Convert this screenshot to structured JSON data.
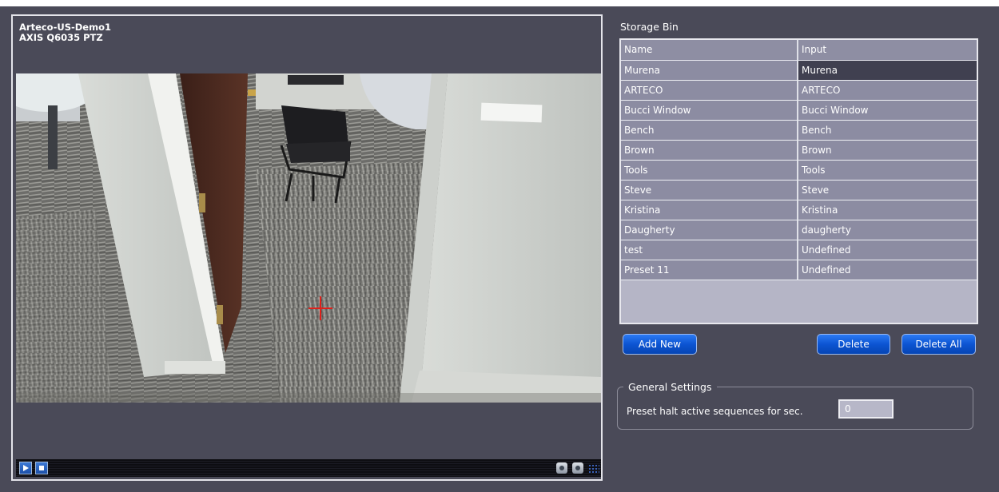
{
  "camera": {
    "name": "Arteco-US-Demo1",
    "model": "AXIS Q6035 PTZ"
  },
  "storage_bin": {
    "title": "Storage Bin",
    "columns": [
      "Name",
      "Input"
    ],
    "rows": [
      [
        "Murena",
        "Murena"
      ],
      [
        "ARTECO",
        "ARTECO"
      ],
      [
        "Bucci Window",
        "Bucci Window"
      ],
      [
        "Bench",
        "Bench"
      ],
      [
        "Brown",
        "Brown"
      ],
      [
        "Tools",
        "Tools"
      ],
      [
        "Steve",
        "Steve"
      ],
      [
        "Kristina",
        "Kristina"
      ],
      [
        "Daugherty",
        "daugherty"
      ],
      [
        "test",
        "Undefined"
      ],
      [
        "Preset 11",
        "Undefined"
      ]
    ],
    "selected_row": 0
  },
  "buttons": {
    "add_new": "Add New",
    "delete": "Delete",
    "delete_all": "Delete All"
  },
  "general_settings": {
    "title": "General Settings",
    "halt_label": "Preset halt active sequences for sec.",
    "halt_value": "0"
  },
  "icons": {
    "play": "play-icon",
    "stop": "stop-icon",
    "snapshot": "snapshot-icon",
    "record": "record-icon",
    "resize_grip": "resize-grip-icon"
  }
}
